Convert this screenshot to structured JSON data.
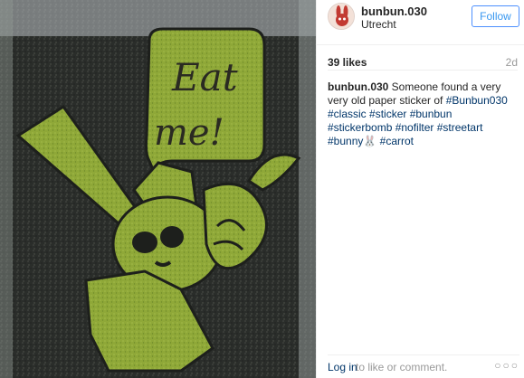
{
  "post": {
    "username": "bunbun.030",
    "location": "Utrecht",
    "follow_label": "Follow",
    "likes": "39 likes",
    "time": "2d",
    "caption": {
      "user": "bunbun.030",
      "text_1": " Someone found a very very old paper sticker of ",
      "tags_1": "#Bunbun030 #classic #sticker #bunbun #stickerbomb #nofilter #streetart #bunny",
      "emoji": "🐰",
      "tags_2": " #carrot"
    },
    "footer": {
      "login_label": "Log in",
      "login_rest": " to like or comment.",
      "more_label": "○○○"
    },
    "image": {
      "sticker_text_1": "Eat",
      "sticker_text_2": "me!"
    }
  },
  "colors": {
    "link": "#003569",
    "follow_blue": "#3897f0",
    "sticker_green": "#8fa838",
    "wall_dark": "#2b2f2c"
  },
  "icons": {
    "more": "ellipsis-icon",
    "avatar": "bunny-avatar-icon"
  }
}
